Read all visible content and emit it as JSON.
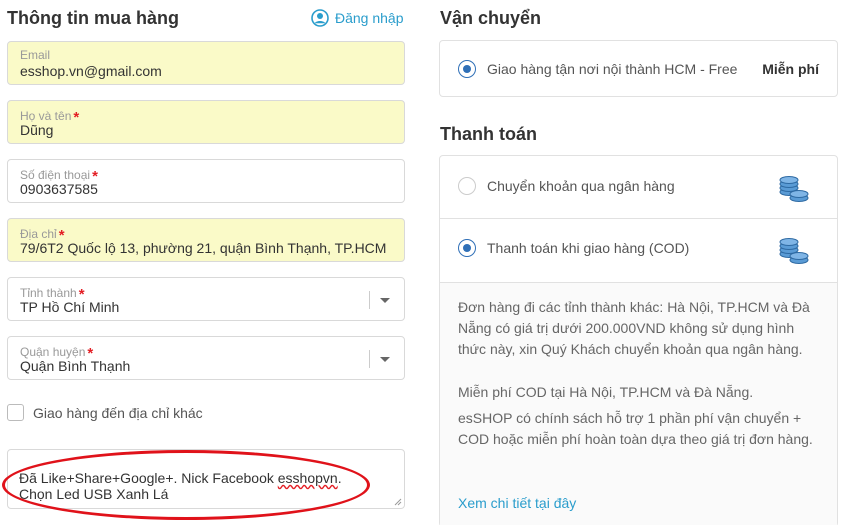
{
  "buyer": {
    "title": "Thông tin mua hàng",
    "login_label": "Đăng nhập",
    "email": {
      "label": "Email",
      "value": "esshop.vn@gmail.com"
    },
    "name": {
      "label": "Họ và tên",
      "value": "Dũng",
      "required_mark": "*"
    },
    "phone": {
      "label": "Số điện thoại",
      "value": "0903637585",
      "required_mark": "*"
    },
    "address": {
      "label": "Địa chỉ",
      "value": "79/6T2 Quốc lộ 13, phường 21, quận Bình Thạnh, TP.HCM",
      "required_mark": "*"
    },
    "province": {
      "label": "Tỉnh thành",
      "value": "TP Hồ Chí Minh",
      "required_mark": "*"
    },
    "district": {
      "label": "Quận huyện",
      "value": "Quận Bình Thạnh",
      "required_mark": "*"
    },
    "alt_address_label": "Giao hàng đến địa chỉ khác",
    "note_line1_before": "Đã Like+Share+Google+. Nick Facebook ",
    "note_line1_misspelled": "esshopvn",
    "note_line1_after": ".",
    "note_line2": "Chọn Led USB Xanh Lá"
  },
  "shipping": {
    "title": "Vận chuyển",
    "option_label": "Giao hàng tận nơi nội thành HCM - Free",
    "option_price": "Miễn phí"
  },
  "payment": {
    "title": "Thanh toán",
    "bank_label": "Chuyển khoản qua ngân hàng",
    "cod_label": "Thanh toán khi giao hàng (COD)",
    "info_p1": "Đơn hàng đi các tỉnh thành khác: Hà Nội, TP.HCM và Đà Nẵng có giá trị dưới 200.000VND không sử dụng hình thức này, xin Quý Khách chuyển khoản qua ngân hàng.",
    "info_p2": "Miễn phí COD tại Hà Nội, TP.HCM và Đà Nẵng.",
    "info_p3": "esSHOP có chính sách hỗ trợ 1 phần phí vận chuyển + COD hoặc miễn phí hoàn toàn dựa theo giá trị đơn hàng.",
    "more_link": "Xem chi tiết tại đây"
  },
  "colors": {
    "accent": "#2a9dcc",
    "autofill": "#fafac8",
    "required": "#e31e24",
    "annotation_ellipse": "#e0121a",
    "radio_selected": "#2f6fb7"
  },
  "icons": [
    "user-icon",
    "chevron-down-icon",
    "coins-icon",
    "resize-handle-icon"
  ]
}
